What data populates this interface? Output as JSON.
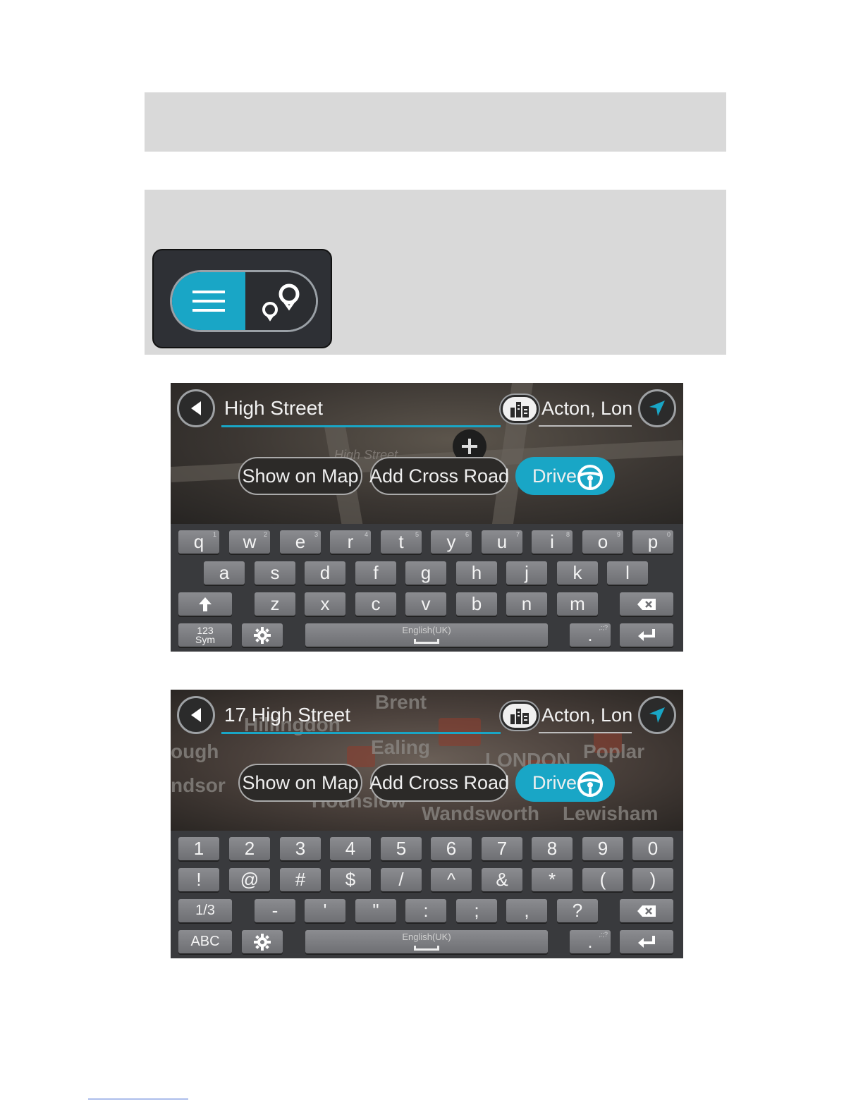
{
  "menu_icons": {
    "left": "menu-lines-icon",
    "right": "route-points-icon",
    "accent": "#19a6c6"
  },
  "screen1": {
    "search_text": "High Street",
    "location_text": "Acton, Lond",
    "map_labels": [
      "High Street"
    ],
    "buttons": {
      "show_on_map": "Show on Map",
      "add_cross_road": "Add Cross Road",
      "drive": "Drive"
    },
    "keyboard": {
      "row1": [
        {
          "k": "q",
          "h": "1"
        },
        {
          "k": "w",
          "h": "2"
        },
        {
          "k": "e",
          "h": "3"
        },
        {
          "k": "r",
          "h": "4"
        },
        {
          "k": "t",
          "h": "5"
        },
        {
          "k": "y",
          "h": "6"
        },
        {
          "k": "u",
          "h": "7"
        },
        {
          "k": "i",
          "h": "8"
        },
        {
          "k": "o",
          "h": "9"
        },
        {
          "k": "p",
          "h": "0"
        }
      ],
      "row2": [
        "a",
        "s",
        "d",
        "f",
        "g",
        "h",
        "j",
        "k",
        "l"
      ],
      "row3": [
        "z",
        "x",
        "c",
        "v",
        "b",
        "n",
        "m"
      ],
      "mode_key_line1": "123",
      "mode_key_line2": "Sym",
      "space_label": "English(UK)",
      "dot_key": ".",
      "dot_hint": ",:;?"
    }
  },
  "screen2": {
    "search_text": "17 High Street",
    "location_text": "Acton, Londo",
    "map_labels": [
      "Brent",
      "Hillingdon",
      "Ealing",
      "LONDON",
      "Poplar",
      "ough",
      "ndsor",
      "Hounslow",
      "Wandsworth",
      "Lewisham"
    ],
    "buttons": {
      "show_on_map": "Show on Map",
      "add_cross_road": "Add Cross Road",
      "drive": "Drive"
    },
    "keyboard": {
      "row1": [
        "1",
        "2",
        "3",
        "4",
        "5",
        "6",
        "7",
        "8",
        "9",
        "0"
      ],
      "row2": [
        "!",
        "@",
        "#",
        "$",
        "/",
        "^",
        "&",
        "*",
        "(",
        ")"
      ],
      "row3": [
        "-",
        "'",
        "\"",
        ":",
        ";",
        ",",
        "?"
      ],
      "page_key": "1/3",
      "mode_key": "ABC",
      "space_label": "English(UK)",
      "dot_key": ".",
      "dot_hint": ",:;?"
    }
  }
}
